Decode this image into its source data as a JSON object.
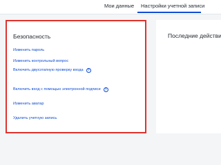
{
  "tabs": {
    "my_data": "Мои данные",
    "account_settings": "Настройки учетной записи"
  },
  "security": {
    "title": "Безопасность",
    "links": [
      {
        "label": "Изменить пароль",
        "help": false
      },
      {
        "label": "Изменить контрольный вопрос",
        "help": false
      },
      {
        "label": "Включить двухэтапную проверку входа",
        "help": true
      },
      {
        "label": "Включить вход с помощью электронной подписи",
        "help": true
      },
      {
        "label": "Изменить аватар",
        "help": false
      },
      {
        "label": "Удалить учетную запись",
        "help": false
      }
    ]
  },
  "recent": {
    "title": "Последние действия"
  },
  "help_glyph": "?",
  "colors": {
    "link": "#0d4cd3",
    "highlight_border": "#e0312c",
    "background": "#f3f5f7"
  }
}
